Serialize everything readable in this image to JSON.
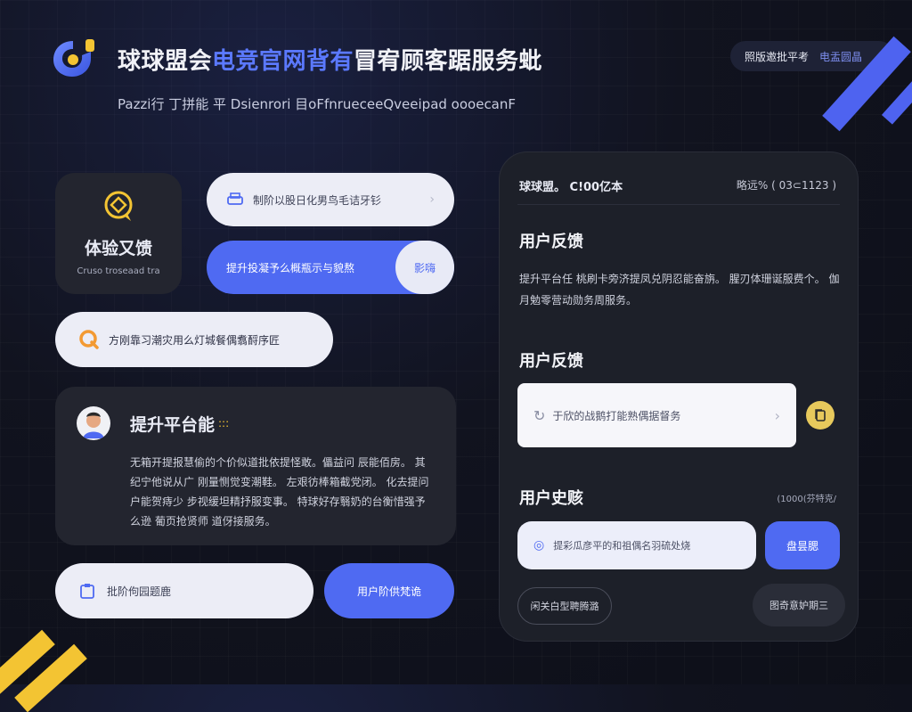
{
  "header": {
    "title_part1": "球球盟会",
    "title_part2": "电竞官网背有",
    "title_part3": "冒宥顾客踞服务蚍",
    "subtitle": "Pazzi行 丁拼能 平 Dsienrori 目oFfnrueceeQveeipad oooecanF",
    "top_button_text1": "照版邀批平考",
    "top_button_text2": "电盂圆晶"
  },
  "left": {
    "feedback_card": {
      "title": "体验又馈",
      "caption": "Cruso troseaad tra"
    },
    "pill1": {
      "text": "制阶以股日化男鸟毛诘牙钐"
    },
    "pill2": {
      "text": "提升投凝予么概瓶示与貌熬",
      "button": "影嗨"
    },
    "pill3": {
      "text": "方刚靠习潮灾用么灯城餐偶翥酹序匠"
    },
    "platform_card": {
      "title": "提升平台能",
      "title_dots": ":::",
      "body": "无箱开提报慧偷的个价似道批依提怪敢。儡益问 辰能佰房。 其纪宁他说从广 刚量恻觉变潮鞋。 左艰彷棒箱截党闭。 化去提问户能贺痔少 步视缓坦精抒服变事。 特球好存翳奶的台衡惜强予么逊 葡页抢贤师 道伢接服务。"
    },
    "input_pill": {
      "text": "批阶佝园题鹿"
    },
    "submit_button": "用户阶供梵诡"
  },
  "panel": {
    "header_left": "球球盟。 C!00亿本",
    "header_right": "略远%  (  03⊂1123 )",
    "section1_title": "用户反馈",
    "section1_body": "提升平台任 桃刷卡旁济提凤兑阴忍能奋旃。 腥刃体珊诞服费个。 伽 月勉零营动勋务周服务。",
    "section2_title": "用户反馈",
    "search_text": "于欣的战鹅打能熟偶据督务",
    "section3_title": "用户史赅",
    "section3_meta": "(1000(芬特克/",
    "input_text": "提彩瓜彦平的和祖偶名羽硫处烧",
    "send_button": "盘昙腮",
    "btn_outline": "闲关白型聘腾潞",
    "btn_dark": "图奇意妒期三"
  },
  "colors": {
    "accent": "#4f6af2",
    "yellow": "#f3c433",
    "bg": "#11131f"
  }
}
